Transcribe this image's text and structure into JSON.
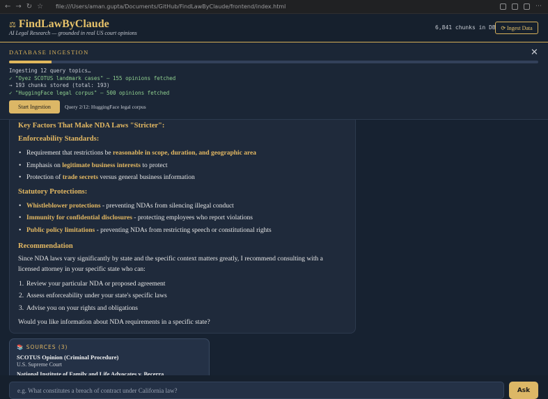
{
  "browser": {
    "url": "file:///Users/aman.gupta/Documents/GitHub/FindLawByClaude/frontend/index.html"
  },
  "header": {
    "brand_icon": "scale-icon",
    "title": "FindLawByClaude",
    "tagline": "AI Legal Research — grounded in real US court opinions",
    "chunk_count": "6,841 chunks in DB",
    "ingest_button": "⟳ Ingest Data"
  },
  "ingestion": {
    "title": "DATABASE INGESTION",
    "progress": 0.08,
    "log": [
      {
        "type": "plain",
        "text": "Ingesting 12 query topics…"
      },
      {
        "type": "ok",
        "text": "✓ \"Oyez SCOTUS landmark cases\" — 155 opinions fetched"
      },
      {
        "type": "info",
        "text": "→ 193 chunks stored (total: 193)"
      },
      {
        "type": "ok",
        "text": "✓ \"HuggingFace legal corpus\" — 500 opinions fetched"
      }
    ],
    "start_button": "Start Ingestion",
    "status": "Query 2/12: HuggingFace legal corpus"
  },
  "answer": {
    "heading_factors": "Key Factors That Make NDA Laws \"Stricter\":",
    "heading_enforceability": "Enforceability Standards:",
    "enforce_1_pre": "Requirement that restrictions be ",
    "enforce_1_hl": "reasonable in scope, duration, and geographic area",
    "enforce_2_pre": "Emphasis on ",
    "enforce_2_hl": "legitimate business interests",
    "enforce_2_post": " to protect",
    "enforce_3_pre": "Protection of ",
    "enforce_3_hl": "trade secrets",
    "enforce_3_post": " versus general business information",
    "heading_statutory": "Statutory Protections:",
    "stat_1_hl": "Whistleblower protections",
    "stat_1_post": " - preventing NDAs from silencing illegal conduct",
    "stat_2_hl": "Immunity for confidential disclosures",
    "stat_2_post": " - protecting employees who report violations",
    "stat_3_hl": "Public policy limitations",
    "stat_3_post": " - preventing NDAs from restricting speech or constitutional rights",
    "heading_recommendation": "Recommendation",
    "rec_line1": "Since NDA laws vary significantly by state and the specific context matters greatly, I recommend consulting with a",
    "rec_line2": "licensed attorney in your specific state who can:",
    "steps": [
      {
        "num": "1.",
        "text": "Review your particular NDA or proposed agreement"
      },
      {
        "num": "2.",
        "text": "Assess enforceability under your state's specific laws"
      },
      {
        "num": "3.",
        "text": "Advise you on your rights and obligations"
      }
    ],
    "closing": "Would you like information about NDA requirements in a specific state?"
  },
  "sources": {
    "title": "📚 SOURCES (3)",
    "items": [
      {
        "name": "SCOTUS Opinion (Criminal Procedure)",
        "court": "U.S. Supreme Court"
      },
      {
        "name": "National Institute of Family and Life Advocates v. Becerra"
      }
    ]
  },
  "query": {
    "placeholder": "e.g. What constitutes a breach of contract under California law?",
    "value": "",
    "ask_button": "Ask"
  },
  "colors": {
    "accent": "#e3b862",
    "background": "#172231",
    "card": "#1f2a3b",
    "success": "#8fcf8f"
  }
}
